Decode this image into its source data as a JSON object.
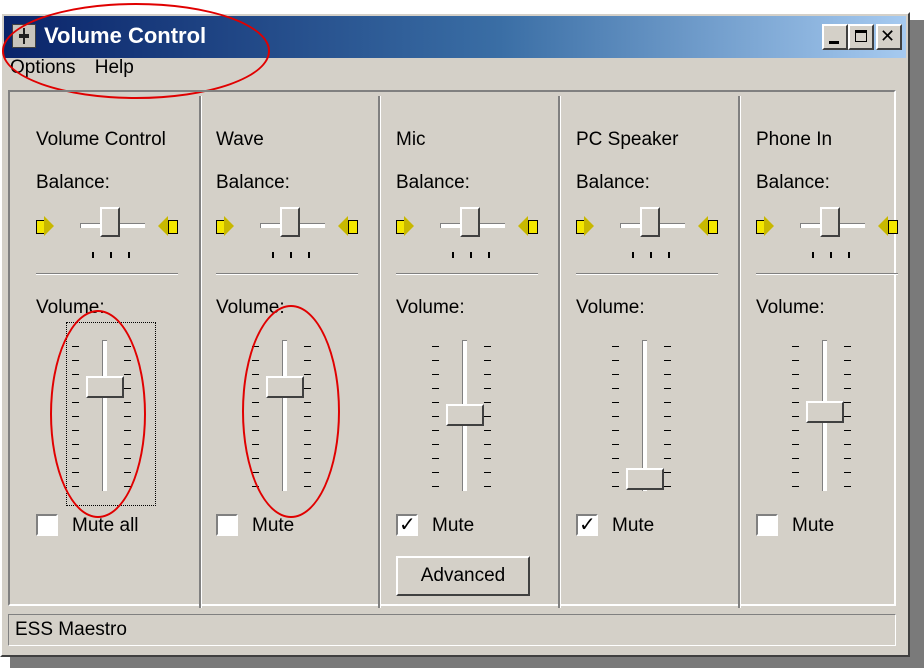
{
  "window": {
    "title": "Volume Control",
    "menu": [
      "Options",
      "Help"
    ],
    "status": "ESS Maestro"
  },
  "channels": [
    {
      "name": "Volume Control",
      "balance_label": "Balance:",
      "volume_label": "Volume:",
      "volume_level": 0.72,
      "mute_label": "Mute all",
      "muted": false
    },
    {
      "name": "Wave",
      "balance_label": "Balance:",
      "volume_label": "Volume:",
      "volume_level": 0.72,
      "mute_label": "Mute",
      "muted": false
    },
    {
      "name": "Mic",
      "balance_label": "Balance:",
      "volume_label": "Volume:",
      "volume_level": 0.5,
      "mute_label": "Mute",
      "muted": true,
      "advanced_label": "Advanced"
    },
    {
      "name": "PC Speaker",
      "balance_label": "Balance:",
      "volume_label": "Volume:",
      "volume_level": 0.0,
      "mute_label": "Mute",
      "muted": true
    },
    {
      "name": "Phone In",
      "balance_label": "Balance:",
      "volume_label": "Volume:",
      "volume_level": 0.52,
      "mute_label": "Mute",
      "muted": false
    }
  ],
  "colors": {
    "annotation": "#e00000",
    "title_start": "#0a246a",
    "title_end": "#a6caf0"
  }
}
